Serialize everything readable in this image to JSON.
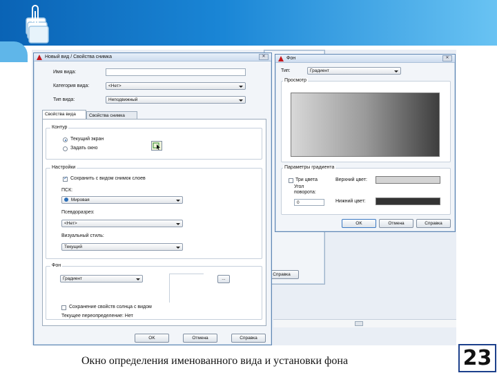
{
  "caption": "Окно определения именованного вида и установки фона",
  "page_number": "23",
  "view_dialog": {
    "title": "Новый вид / Свойства снимка",
    "name_label": "Имя вида:",
    "name_value": "",
    "category_label": "Категория вида:",
    "category_value": "<Нет>",
    "type_label": "Тип вида:",
    "type_value": "Неподвижный",
    "tabs": [
      "Свойства вида",
      "Свойства снимка"
    ],
    "contour": {
      "title": "Контур",
      "opt_current": "Текущий экран",
      "opt_window": "Задать окно"
    },
    "settings": {
      "title": "Настройки",
      "save_layers": "Сохранить с видом снимок слоев",
      "ucs_label": "ПСК:",
      "ucs_value": "Мировая",
      "section_label": "Псевдоразрез:",
      "section_value": "<Нет>",
      "visual_label": "Визуальный стиль:",
      "visual_value": "Текущий"
    },
    "background": {
      "title": "Фон",
      "value": "Градиент",
      "browse": "...",
      "sun_label": "Сохранение свойств солнца с видом",
      "override_label": "Текущее переопределение: Нет"
    },
    "ok": "OK",
    "cancel": "Отмена",
    "help": "Справка"
  },
  "bg_dialog": {
    "title": "Фон",
    "type_label": "Тип:",
    "type_value": "Градиент",
    "preview_label": "Просмотр",
    "params_label": "Параметры градиента",
    "three_colors": "Три цвета",
    "angle_label": "Угол поворота:",
    "angle_value": "0",
    "top_color_label": "Верхний цвет:",
    "bottom_color_label": "Нижний цвет:",
    "top_color": "#d4d4d4",
    "bottom_color": "#333333",
    "ok": "OK",
    "cancel": "Отмена",
    "help": "Справка"
  },
  "behind_dialog": {
    "help": "Справка"
  }
}
